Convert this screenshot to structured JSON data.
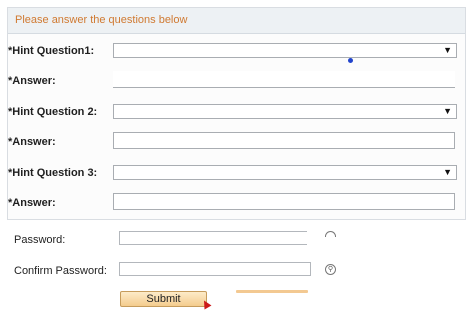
{
  "panel": {
    "title": "Please answer the questions below"
  },
  "questions": [
    {
      "hint_label": "*Hint Question1:",
      "answer_label": "*Answer:",
      "selected": ""
    },
    {
      "hint_label": "*Hint Question 2:",
      "answer_label": "*Answer:",
      "selected": ""
    },
    {
      "hint_label": "*Hint Question 3:",
      "answer_label": "*Answer:",
      "selected": ""
    }
  ],
  "password": {
    "label": "Password:",
    "value": ""
  },
  "confirm_password": {
    "label": "Confirm Password:",
    "value": ""
  },
  "submit": {
    "label": "Submit"
  },
  "icons": {
    "dropdown": "chevron-down-icon",
    "password_toggle": "eye-icon"
  },
  "colors": {
    "panel_title": "#d07a32",
    "button": "#f4cc8e",
    "cursor": "#cc1a1a",
    "dot": "#2244cc"
  }
}
